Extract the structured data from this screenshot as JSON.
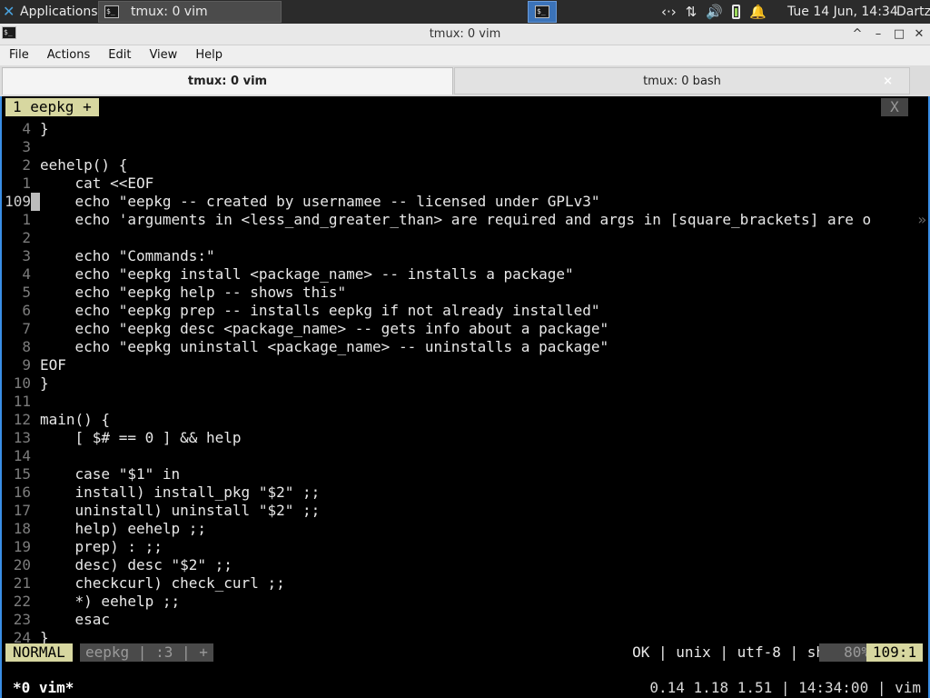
{
  "panel": {
    "applications_label": "Applications",
    "task_label": "tmux: 0 vim",
    "clock": "Tue 14 Jun, 14:34",
    "user": "Dartz"
  },
  "window": {
    "title": "tmux: 0 vim",
    "controls": [
      "^",
      "–",
      "□",
      "✕"
    ]
  },
  "menu": [
    "File",
    "Actions",
    "Edit",
    "View",
    "Help"
  ],
  "tabs": [
    {
      "label": "tmux: 0 vim",
      "active": true
    },
    {
      "label": "tmux: 0 bash",
      "active": false,
      "close": "×"
    }
  ],
  "vim": {
    "tabline": {
      "buffer": "1  eepkg  +",
      "close": "X"
    },
    "lines": [
      {
        "n": "4",
        "t": "}"
      },
      {
        "n": "3",
        "t": ""
      },
      {
        "n": "2",
        "t": "eehelp() {"
      },
      {
        "n": "1",
        "t": "    cat <<EOF"
      },
      {
        "n": "109",
        "t": "    echo \"eepkg -- created by usernamee -- licensed under GPLv3\"",
        "cursor": true
      },
      {
        "n": "1",
        "t": "    echo 'arguments in <less_and_greater_than> are required and args in [square_brackets] are o",
        "trunc": "»"
      },
      {
        "n": "2",
        "t": ""
      },
      {
        "n": "3",
        "t": "    echo \"Commands:\""
      },
      {
        "n": "4",
        "t": "    echo \"eepkg install <package_name> -- installs a package\""
      },
      {
        "n": "5",
        "t": "    echo \"eepkg help -- shows this\""
      },
      {
        "n": "6",
        "t": "    echo \"eepkg prep -- installs eepkg if not already installed\""
      },
      {
        "n": "7",
        "t": "    echo \"eepkg desc <package_name> -- gets info about a package\""
      },
      {
        "n": "8",
        "t": "    echo \"eepkg uninstall <package_name> -- uninstalls a package\""
      },
      {
        "n": "9",
        "t": "EOF"
      },
      {
        "n": "10",
        "t": "}"
      },
      {
        "n": "11",
        "t": ""
      },
      {
        "n": "12",
        "t": "main() {"
      },
      {
        "n": "13",
        "t": "    [ $# == 0 ] && help"
      },
      {
        "n": "14",
        "t": ""
      },
      {
        "n": "15",
        "t": "    case \"$1\" in"
      },
      {
        "n": "16",
        "t": "    install) install_pkg \"$2\" ;;"
      },
      {
        "n": "17",
        "t": "    uninstall) uninstall \"$2\" ;;"
      },
      {
        "n": "18",
        "t": "    help) eehelp ;;"
      },
      {
        "n": "19",
        "t": "    prep) : ;;"
      },
      {
        "n": "20",
        "t": "    desc) desc \"$2\" ;;"
      },
      {
        "n": "21",
        "t": "    checkcurl) check_curl ;;"
      },
      {
        "n": "22",
        "t": "    *) eehelp ;;"
      },
      {
        "n": "23",
        "t": "    esac"
      },
      {
        "n": "24",
        "t": "}"
      }
    ],
    "status": {
      "mode": "NORMAL",
      "file": "eepkg  | :3  |  +",
      "right": "OK | unix | utf-8 | sh",
      "percent": "80%",
      "position": "109:1"
    }
  },
  "tmux": {
    "window": "*0 vim*",
    "stats": "0.14 1.18 1.51 | 14:34:00 | vim"
  }
}
